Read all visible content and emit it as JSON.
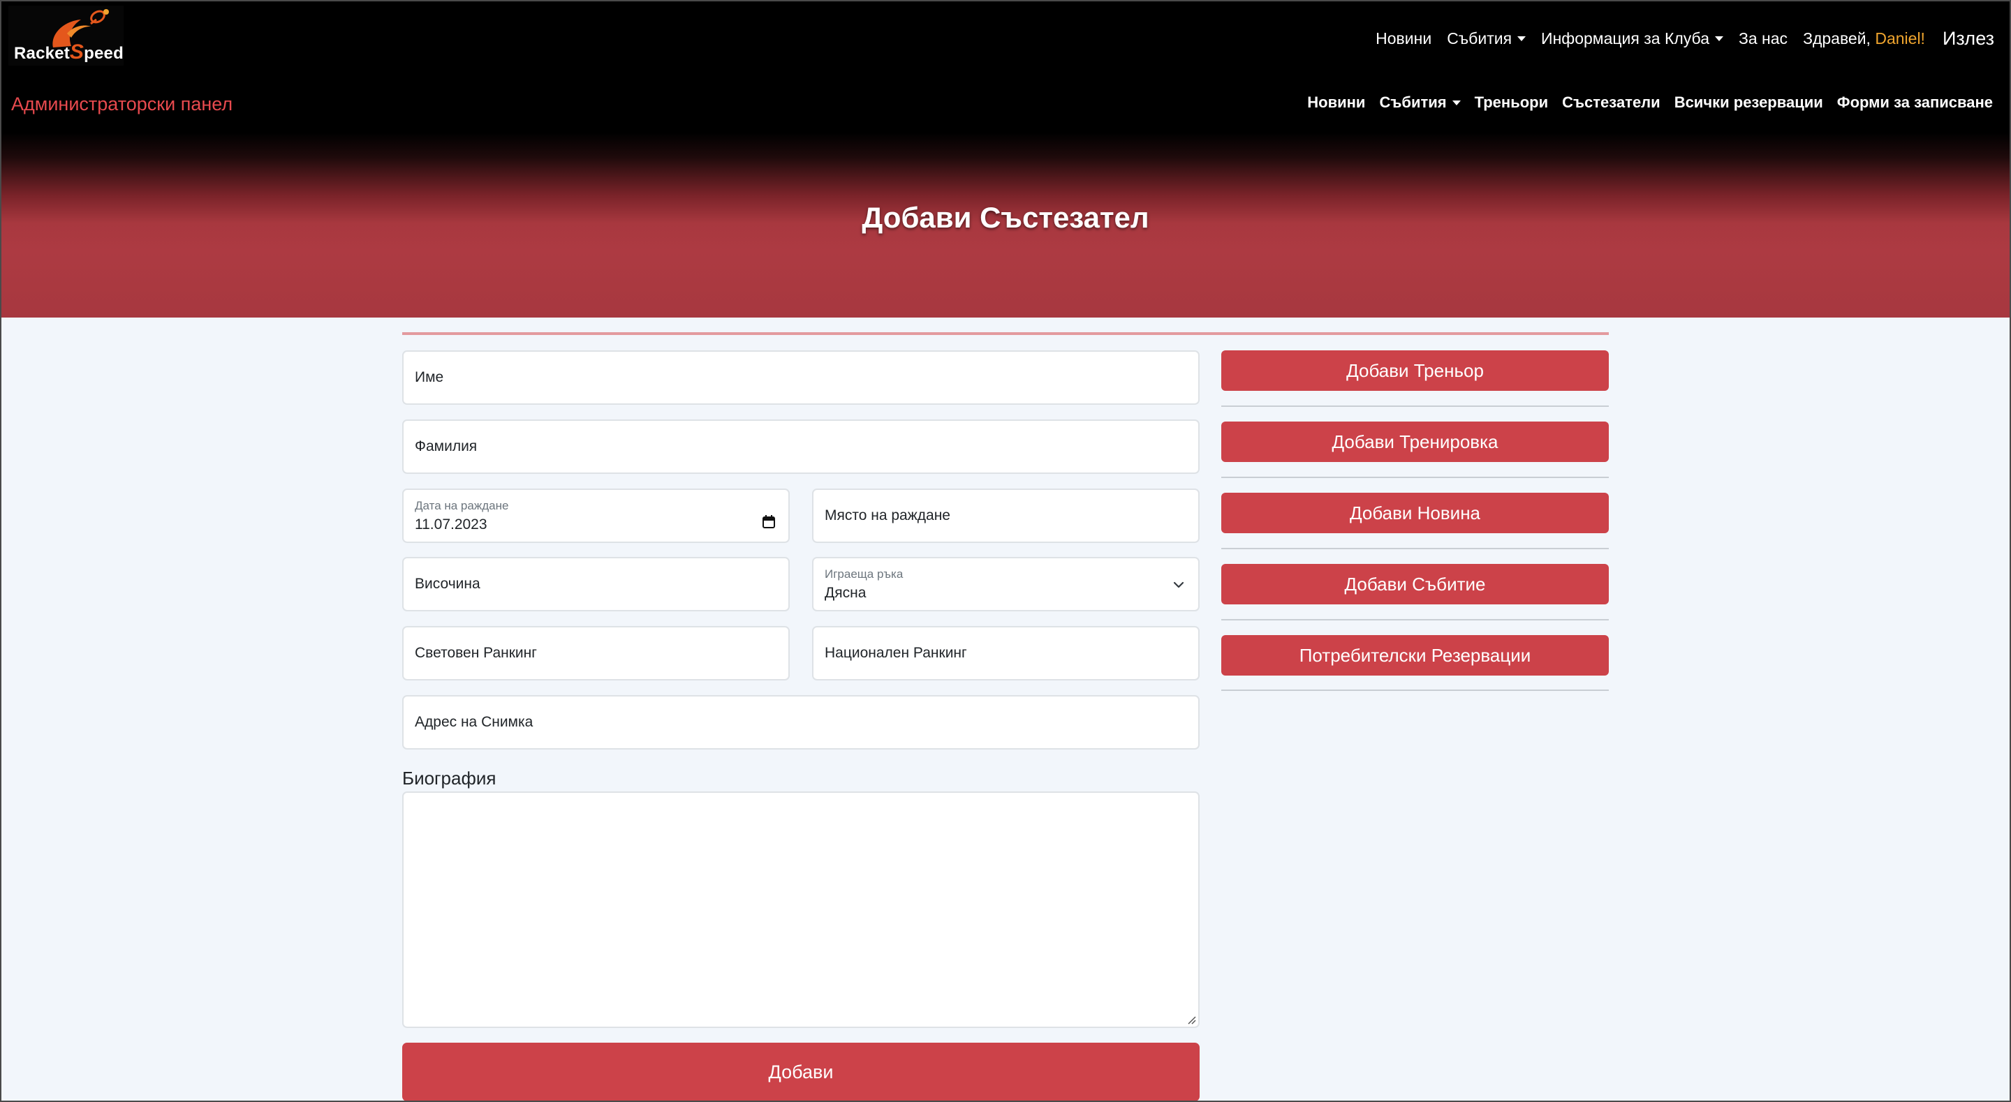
{
  "brand": {
    "name": "RacketSpeed",
    "logo_letters": [
      "Racket",
      "Speed"
    ]
  },
  "nav_top": {
    "items": [
      {
        "label": "Новини",
        "dropdown": false
      },
      {
        "label": "Събития",
        "dropdown": true
      },
      {
        "label": "Информация за Клуба",
        "dropdown": true
      },
      {
        "label": "За нас",
        "dropdown": false
      }
    ],
    "greeting": "Здравей,",
    "user_name": "Daniel!",
    "logout": "Излез"
  },
  "admin_nav": {
    "title": "Администраторски панел",
    "items": [
      {
        "label": "Новини",
        "dropdown": false
      },
      {
        "label": "Събития",
        "dropdown": true
      },
      {
        "label": "Треньори",
        "dropdown": false
      },
      {
        "label": "Състезатели",
        "dropdown": false
      },
      {
        "label": "Всички резервации",
        "dropdown": false
      },
      {
        "label": "Форми за записване",
        "dropdown": false
      }
    ]
  },
  "page": {
    "heading": "Добави Състезател"
  },
  "form": {
    "first_name": {
      "placeholder": "Име"
    },
    "last_name": {
      "placeholder": "Фамилия"
    },
    "birth_date": {
      "label": "Дата на раждане",
      "value": "11.07.2023"
    },
    "birth_place": {
      "placeholder": "Място на раждане"
    },
    "height": {
      "placeholder": "Височина"
    },
    "playing_hand": {
      "label": "Играеща ръка",
      "value": "Дясна"
    },
    "world_ranking": {
      "placeholder": "Световен Ранкинг"
    },
    "national_ranking": {
      "placeholder": "Национален Ранкинг"
    },
    "photo_url": {
      "placeholder": "Адрес на Снимка"
    },
    "biography": {
      "label": "Биография",
      "value": ""
    },
    "submit": "Добави"
  },
  "sidebar": {
    "buttons": [
      "Добави Треньор",
      "Добави Тренировка",
      "Добави Новина",
      "Добави Събитие",
      "Потребителски Резервации"
    ]
  },
  "colors": {
    "accent": "#cc4249",
    "admin_title": "#e74a4e",
    "user_name": "#f0a52e",
    "background": "#f2f6fb"
  }
}
